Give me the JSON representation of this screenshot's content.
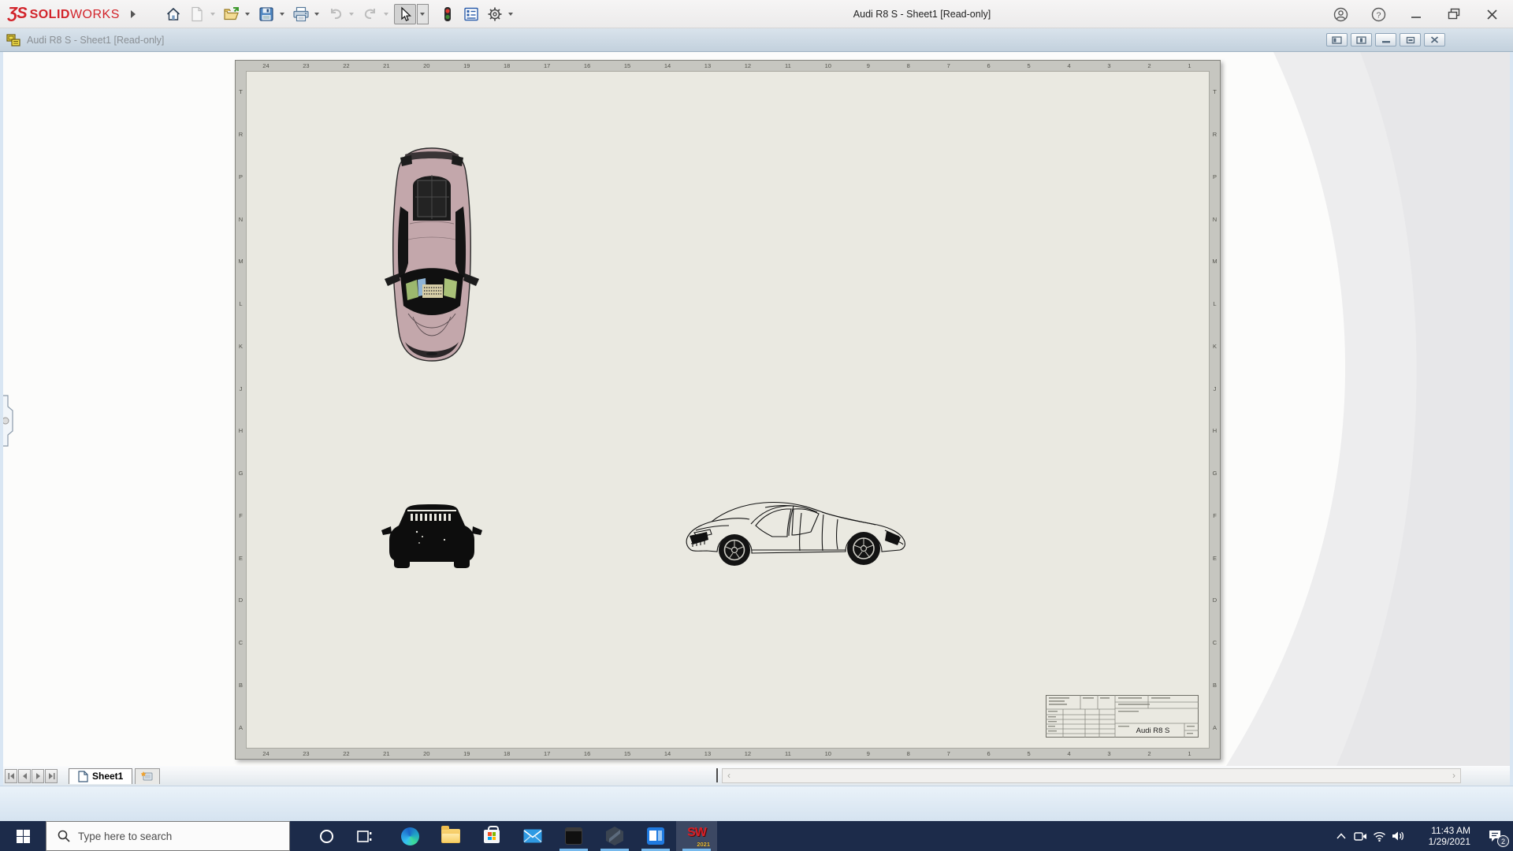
{
  "titlebar": {
    "logo_mark": "ƷS",
    "brand_solid": "SOLID",
    "brand_works": "WORKS",
    "title": "Audi R8 S - Sheet1 [Read-only]",
    "icons": [
      "home-icon",
      "new-document-icon",
      "open-icon",
      "save-icon",
      "print-icon",
      "undo-icon",
      "redo-icon",
      "select-cursor-icon",
      "traffic-light-icon",
      "document-properties-icon",
      "options-gear-icon",
      "account-icon",
      "help-icon",
      "minimize-icon",
      "restore-icon",
      "close-icon"
    ]
  },
  "docbar": {
    "title": "Audi R8 S - Sheet1 [Read-only]",
    "icons": [
      "drawing-document-icon",
      "pane-left-icon",
      "pane-right-icon",
      "minimize-icon",
      "restore-icon",
      "close-icon"
    ]
  },
  "sheet": {
    "ruler_numbers": [
      "24",
      "23",
      "22",
      "21",
      "20",
      "19",
      "18",
      "17",
      "16",
      "15",
      "14",
      "13",
      "12",
      "11",
      "10",
      "9",
      "8",
      "7",
      "6",
      "5",
      "4",
      "3",
      "2",
      "1"
    ],
    "ruler_letters": [
      "T",
      "R",
      "P",
      "N",
      "M",
      "L",
      "K",
      "J",
      "H",
      "G",
      "F",
      "E",
      "D",
      "C",
      "B",
      "A"
    ],
    "views": [
      "top-view-shaded",
      "front-view-silhouette",
      "side-view-wireframe"
    ],
    "title_block": {
      "part_title": "Audi R8 S"
    },
    "colors": {
      "sheet_bg": "#eae9e1",
      "ruler_bg": "#c6c6c0",
      "car_body_pink": "#c3a7ab"
    }
  },
  "tabbar": {
    "sheet_tab_label": "Sheet1",
    "scroll_left": "‹",
    "scroll_right": "›"
  },
  "taskbar": {
    "search_placeholder": "Type here to search",
    "apps": [
      "edge",
      "file-explorer",
      "store",
      "mail",
      "command-prompt",
      "hexagon-app",
      "uwp-app",
      "solidworks-2021"
    ],
    "sw_label": "SW",
    "sw_year": "2021",
    "clock_time": "11:43 AM",
    "clock_date": "1/29/2021",
    "notification_count": "2",
    "bg_color": "#1c2b4a",
    "accent_red": "#d2232a"
  }
}
